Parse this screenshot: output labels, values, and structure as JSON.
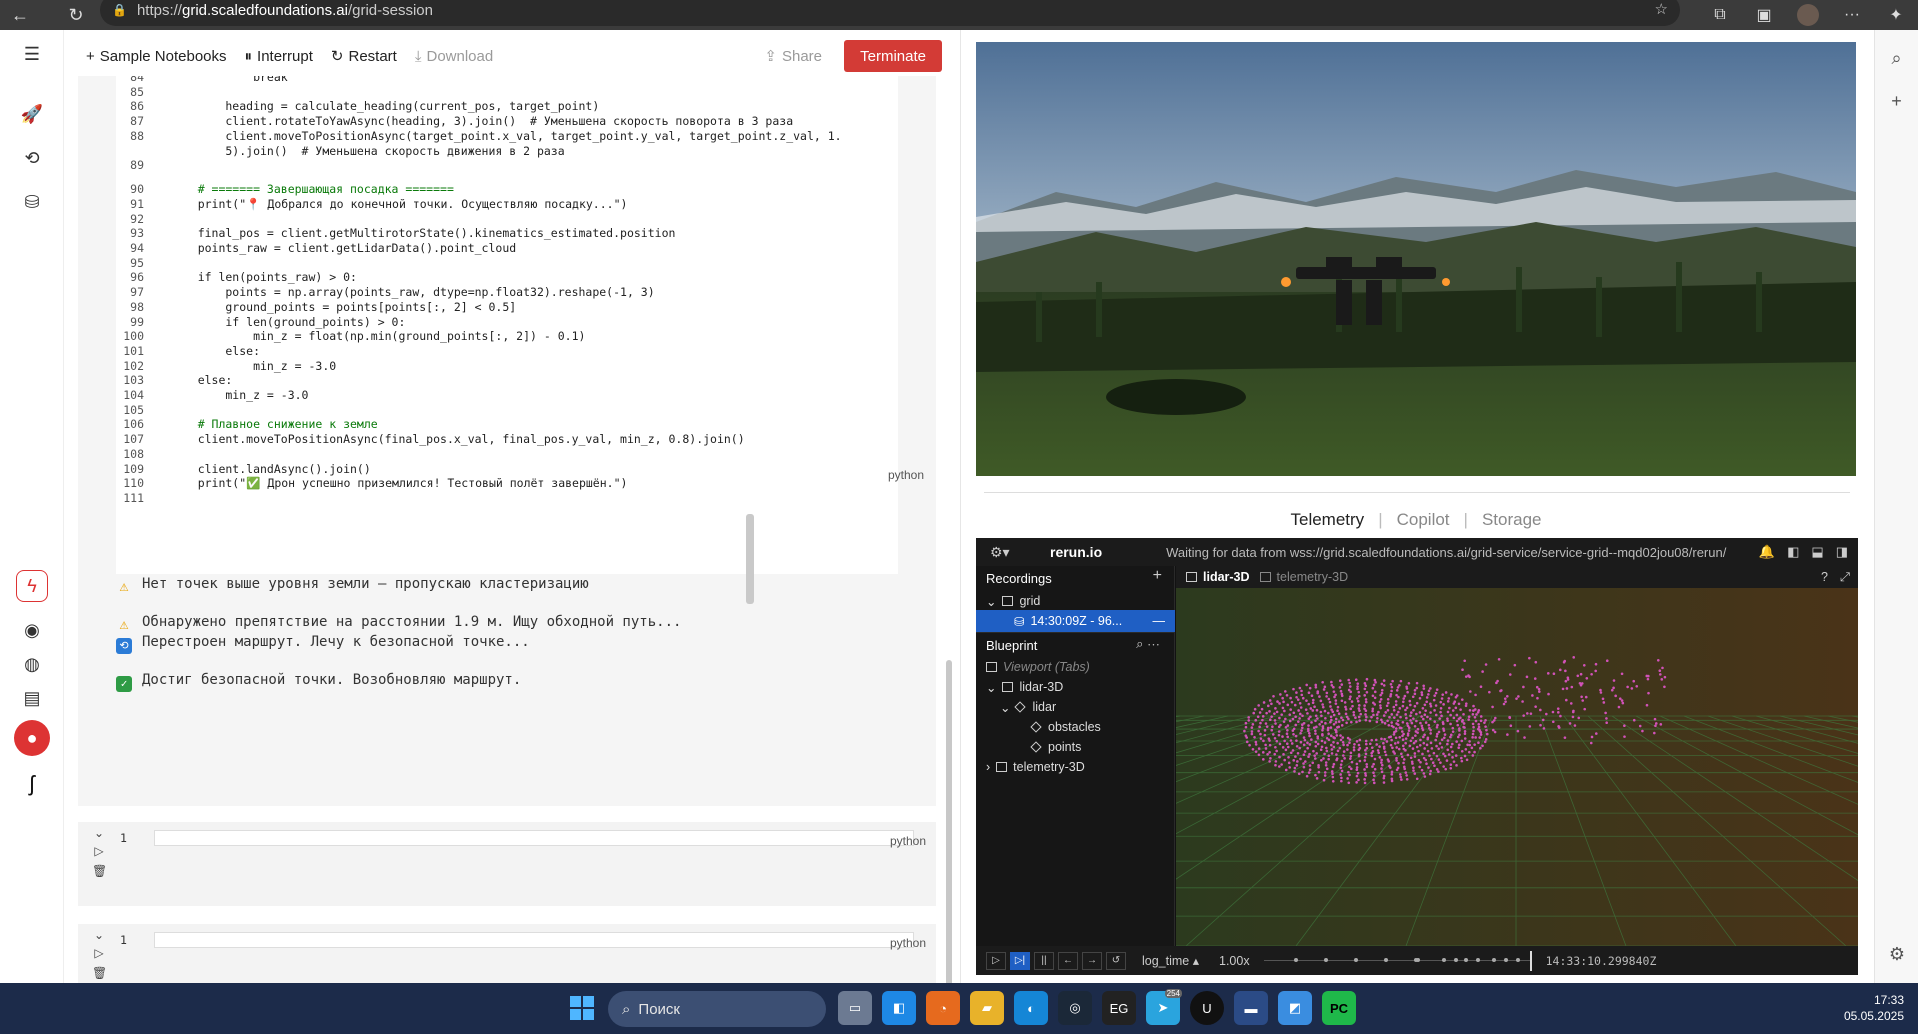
{
  "browser": {
    "url_prefix": "https://",
    "url_host": "grid.scaledfoundations.ai",
    "url_path": "/grid-session"
  },
  "toolbar": {
    "sample_notebooks": "Sample Notebooks",
    "interrupt": "Interrupt",
    "restart": "Restart",
    "download": "Download",
    "share": "Share",
    "terminate": "Terminate"
  },
  "code": {
    "language": "python",
    "lines": [
      {
        "n": "84",
        "t": "            break"
      },
      {
        "n": "85",
        "t": ""
      },
      {
        "n": "86",
        "t": "        heading = calculate_heading(current_pos, target_point)"
      },
      {
        "n": "87",
        "t": "        client.rotateToYawAsync(heading, 3).join()  # Уменьшена скорость поворота в 3 раза"
      },
      {
        "n": "88",
        "t": "        client.moveToPositionAsync(target_point.x_val, target_point.y_val, target_point.z_val, 1."
      },
      {
        "n": "",
        "t": "        5).join()  # Уменьшена скорость движения в 2 раза"
      },
      {
        "n": "89",
        "t": ""
      },
      {
        "n": "90",
        "t": "    # ======= Завершающая посадка ======="
      },
      {
        "n": "91",
        "t": "    print(\"📍 Добрался до конечной точки. Осуществляю посадку...\")"
      },
      {
        "n": "92",
        "t": ""
      },
      {
        "n": "93",
        "t": "    final_pos = client.getMultirotorState().kinematics_estimated.position"
      },
      {
        "n": "94",
        "t": "    points_raw = client.getLidarData().point_cloud"
      },
      {
        "n": "95",
        "t": ""
      },
      {
        "n": "96",
        "t": "    if len(points_raw) > 0:"
      },
      {
        "n": "97",
        "t": "        points = np.array(points_raw, dtype=np.float32).reshape(-1, 3)"
      },
      {
        "n": "98",
        "t": "        ground_points = points[points[:, 2] < 0.5]"
      },
      {
        "n": "99",
        "t": "        if len(ground_points) > 0:"
      },
      {
        "n": "100",
        "t": "            min_z = float(np.min(ground_points[:, 2]) - 0.1)"
      },
      {
        "n": "101",
        "t": "        else:"
      },
      {
        "n": "102",
        "t": "            min_z = -3.0"
      },
      {
        "n": "103",
        "t": "    else:"
      },
      {
        "n": "104",
        "t": "        min_z = -3.0"
      },
      {
        "n": "105",
        "t": ""
      },
      {
        "n": "106",
        "t": "    # Плавное снижение к земле"
      },
      {
        "n": "107",
        "t": "    client.moveToPositionAsync(final_pos.x_val, final_pos.y_val, min_z, 0.8).join()"
      },
      {
        "n": "108",
        "t": ""
      },
      {
        "n": "109",
        "t": "    client.landAsync().join()"
      },
      {
        "n": "110",
        "t": "    print(\"✅ Дрон успешно приземлился! Тестовый полёт завершён.\")"
      },
      {
        "n": "111",
        "t": ""
      }
    ]
  },
  "output": {
    "lines": [
      {
        "icon": "warning",
        "text": "Нет точек выше уровня земли — пропускаю кластеризацию"
      },
      {
        "icon": "warning",
        "text": "Обнаружено препятствие на расстоянии 1.9 м. Ищу обходной путь..."
      },
      {
        "icon": "loop",
        "text": "Перестроен маршрут. Лечу к безопасной точке..."
      },
      {
        "icon": "check",
        "text": "Достиг безопасной точки. Возобновляю маршрут."
      }
    ]
  },
  "empty_cells": [
    {
      "line": "1",
      "language": "python"
    },
    {
      "line": "1",
      "language": "python"
    }
  ],
  "panel_tabs": {
    "telemetry": "Telemetry",
    "copilot": "Copilot",
    "storage": "Storage",
    "sep": "|"
  },
  "rerun": {
    "title": "rerun.io",
    "status": "Waiting for data from wss://grid.scaledfoundations.ai/grid-service/service-grid--mqd02jou08/rerun/",
    "recordings_label": "Recordings",
    "recording_app": "grid",
    "recording_item": "14:30:09Z - 96...",
    "blueprint_label": "Blueprint",
    "viewport": "Viewport (Tabs)",
    "tree": [
      "lidar-3D",
      "lidar",
      "obstacles",
      "points",
      "telemetry-3D"
    ],
    "view_tabs": [
      "lidar-3D",
      "telemetry-3D"
    ],
    "timeline": "log_time",
    "speed": "1.00x",
    "time": "14:33:10.299840Z",
    "help": "?",
    "point_color": "#d152b8"
  },
  "taskbar": {
    "search": "Поиск",
    "time": "17:33",
    "date": "05.05.2025",
    "badge": "254"
  },
  "colors": {
    "accent": "#d33b36",
    "rerun_select": "#1f5fc4"
  }
}
